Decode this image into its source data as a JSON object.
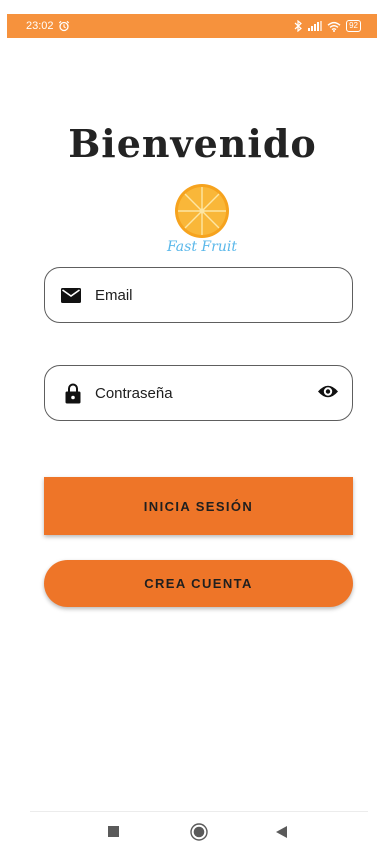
{
  "status_bar": {
    "time": "23:02",
    "battery": "92",
    "accent_color": "#f6923d",
    "icons": [
      "alarm-icon",
      "bluetooth-icon",
      "signal-icon",
      "wifi-icon",
      "battery-icon"
    ]
  },
  "login": {
    "title": "Bienvenido",
    "logo_text": "Fast Fruit",
    "email": {
      "placeholder": "Email",
      "icon": "email-icon"
    },
    "password": {
      "placeholder": "Contraseña",
      "icon": "lock-icon",
      "toggle_icon": "eye-icon"
    },
    "login_button": "INICIA SESIÓN",
    "register_button": "CREA CUENTA",
    "button_color": "#ee7528"
  },
  "nav_bar": {
    "icons": [
      "recents-icon",
      "home-icon",
      "back-icon"
    ]
  }
}
